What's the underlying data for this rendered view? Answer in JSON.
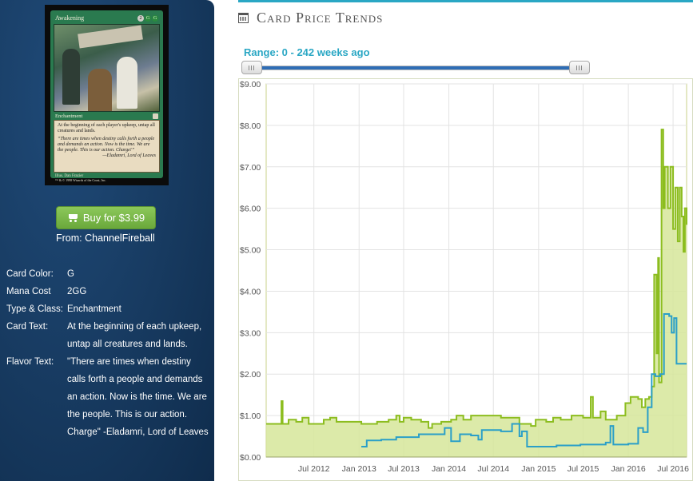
{
  "card": {
    "name": "Awakening",
    "mana_cost_symbols": [
      "2",
      "G",
      "G"
    ],
    "type_line": "Enchantment",
    "rules_text": "At the beginning of each player's upkeep, untap all creatures and lands.",
    "flavor_text": "“There are times when destiny calls forth a people and demands an action. Now is the time. We are the people. This is our action. Charge!”",
    "flavor_signature": "—Eladamri, Lord of Leaves",
    "illustrator": "Illus. Dan Frazier",
    "copyright": "™ & © 1998 Wizards of the Coast, Inc."
  },
  "buy": {
    "label": "Buy for $3.99",
    "from": "From: ChannelFireball"
  },
  "details": [
    {
      "label": "Card Color:",
      "value": "G"
    },
    {
      "label": "Mana Cost",
      "value": "2GG"
    },
    {
      "label": "Type & Class:",
      "value": "Enchantment"
    },
    {
      "label": "Card Text:",
      "value": "At the beginning of each upkeep, untap all creatures and lands."
    },
    {
      "label": "Flavor Text:",
      "value": "\"There are times when destiny calls forth a people and demands an action. Now is the time. We are the people. This is our action. Charge\" -Eladamri, Lord of Leaves"
    }
  ],
  "header": {
    "title": "Card Price Trends"
  },
  "range": {
    "label": "Range: 0 - 242 weeks ago",
    "start_fraction": 0,
    "end_fraction": 1
  },
  "colors": {
    "accent": "#2aa7c4",
    "slider": "#2e6db5",
    "series_green": "#8cbd1f",
    "series_blue": "#2a9fc8",
    "buy_button": "#7ab84a"
  },
  "chart_data": {
    "type": "area",
    "ylim": [
      0,
      9
    ],
    "yticks": [
      "$0.00",
      "$1.00",
      "$2.00",
      "$3.00",
      "$4.00",
      "$5.00",
      "$6.00",
      "$7.00",
      "$8.00",
      "$9.00"
    ],
    "xlim": [
      "2011-12-20",
      "2016-08-25"
    ],
    "xticks": [
      "Jul 2012",
      "Jan 2013",
      "Jul 2013",
      "Jan 2014",
      "Jul 2014",
      "Jan 2015",
      "Jul 2015",
      "Jan 2016",
      "Jul 2016"
    ],
    "xtick_dates": [
      "2012-07-01",
      "2013-01-01",
      "2013-07-01",
      "2014-01-01",
      "2014-07-01",
      "2015-01-01",
      "2015-07-01",
      "2016-01-01",
      "2016-07-01"
    ],
    "grid": true,
    "series": [
      {
        "style": "area",
        "points": [
          [
            "2011-12-20",
            0.8
          ],
          [
            "2012-02-01",
            0.8
          ],
          [
            "2012-02-20",
            1.35
          ],
          [
            "2012-02-25",
            0.8
          ],
          [
            "2012-03-20",
            0.9
          ],
          [
            "2012-04-20",
            0.85
          ],
          [
            "2012-05-15",
            0.95
          ],
          [
            "2012-06-10",
            0.8
          ],
          [
            "2012-07-20",
            0.8
          ],
          [
            "2012-08-10",
            0.9
          ],
          [
            "2012-09-05",
            0.95
          ],
          [
            "2012-10-01",
            0.85
          ],
          [
            "2012-12-15",
            0.85
          ],
          [
            "2013-01-10",
            0.8
          ],
          [
            "2013-03-15",
            0.85
          ],
          [
            "2013-05-01",
            0.9
          ],
          [
            "2013-06-01",
            1.0
          ],
          [
            "2013-06-15",
            0.85
          ],
          [
            "2013-07-01",
            0.95
          ],
          [
            "2013-08-01",
            0.9
          ],
          [
            "2013-09-10",
            0.85
          ],
          [
            "2013-10-10",
            0.7
          ],
          [
            "2013-10-25",
            0.8
          ],
          [
            "2013-12-01",
            0.85
          ],
          [
            "2014-01-10",
            0.9
          ],
          [
            "2014-02-01",
            1.0
          ],
          [
            "2014-03-01",
            0.9
          ],
          [
            "2014-04-01",
            1.0
          ],
          [
            "2014-06-01",
            1.0
          ],
          [
            "2014-08-01",
            0.95
          ],
          [
            "2014-10-15",
            0.8
          ],
          [
            "2014-12-01",
            0.75
          ],
          [
            "2014-12-20",
            0.9
          ],
          [
            "2015-02-01",
            0.85
          ],
          [
            "2015-03-01",
            0.95
          ],
          [
            "2015-04-01",
            0.9
          ],
          [
            "2015-05-15",
            1.0
          ],
          [
            "2015-07-01",
            0.95
          ],
          [
            "2015-08-01",
            1.45
          ],
          [
            "2015-08-10",
            0.95
          ],
          [
            "2015-09-10",
            1.1
          ],
          [
            "2015-10-01",
            0.9
          ],
          [
            "2015-11-15",
            1.0
          ],
          [
            "2015-12-20",
            1.3
          ],
          [
            "2016-01-10",
            1.45
          ],
          [
            "2016-02-10",
            1.4
          ],
          [
            "2016-02-25",
            1.2
          ],
          [
            "2016-03-10",
            1.4
          ],
          [
            "2016-03-25",
            1.45
          ],
          [
            "2016-04-05",
            1.7
          ],
          [
            "2016-04-15",
            4.4
          ],
          [
            "2016-04-25",
            2.5
          ],
          [
            "2016-05-01",
            4.8
          ],
          [
            "2016-05-05",
            1.8
          ],
          [
            "2016-05-15",
            7.9
          ],
          [
            "2016-05-22",
            6.0
          ],
          [
            "2016-05-28",
            7.0
          ],
          [
            "2016-06-10",
            6.0
          ],
          [
            "2016-06-20",
            7.0
          ],
          [
            "2016-07-01",
            5.5
          ],
          [
            "2016-07-10",
            6.5
          ],
          [
            "2016-07-20",
            5.2
          ],
          [
            "2016-07-28",
            6.5
          ],
          [
            "2016-08-05",
            5.8
          ],
          [
            "2016-08-12",
            4.95
          ],
          [
            "2016-08-18",
            6.0
          ],
          [
            "2016-08-25",
            5.6
          ]
        ]
      },
      {
        "style": "line",
        "points": [
          [
            "2013-01-10",
            0.25
          ],
          [
            "2013-02-01",
            0.4
          ],
          [
            "2013-04-01",
            0.42
          ],
          [
            "2013-06-01",
            0.48
          ],
          [
            "2013-09-01",
            0.55
          ],
          [
            "2013-12-15",
            0.7
          ],
          [
            "2014-01-10",
            0.38
          ],
          [
            "2014-02-15",
            0.55
          ],
          [
            "2014-04-01",
            0.52
          ],
          [
            "2014-05-01",
            0.42
          ],
          [
            "2014-05-15",
            0.65
          ],
          [
            "2014-08-01",
            0.62
          ],
          [
            "2014-09-15",
            0.8
          ],
          [
            "2014-10-15",
            0.5
          ],
          [
            "2014-10-25",
            0.62
          ],
          [
            "2014-11-15",
            0.25
          ],
          [
            "2015-03-15",
            0.28
          ],
          [
            "2015-06-10",
            0.28
          ],
          [
            "2015-06-20",
            0.3
          ],
          [
            "2015-10-01",
            0.35
          ],
          [
            "2015-10-20",
            0.75
          ],
          [
            "2015-11-01",
            0.3
          ],
          [
            "2016-01-01",
            0.32
          ],
          [
            "2016-02-10",
            0.7
          ],
          [
            "2016-03-01",
            0.6
          ],
          [
            "2016-03-20",
            1.2
          ],
          [
            "2016-04-05",
            2.0
          ],
          [
            "2016-04-20",
            1.95
          ],
          [
            "2016-05-10",
            2.0
          ],
          [
            "2016-05-25",
            3.45
          ],
          [
            "2016-06-15",
            3.4
          ],
          [
            "2016-06-25",
            3.0
          ],
          [
            "2016-07-05",
            3.35
          ],
          [
            "2016-07-15",
            2.25
          ],
          [
            "2016-08-25",
            2.25
          ]
        ]
      }
    ]
  }
}
